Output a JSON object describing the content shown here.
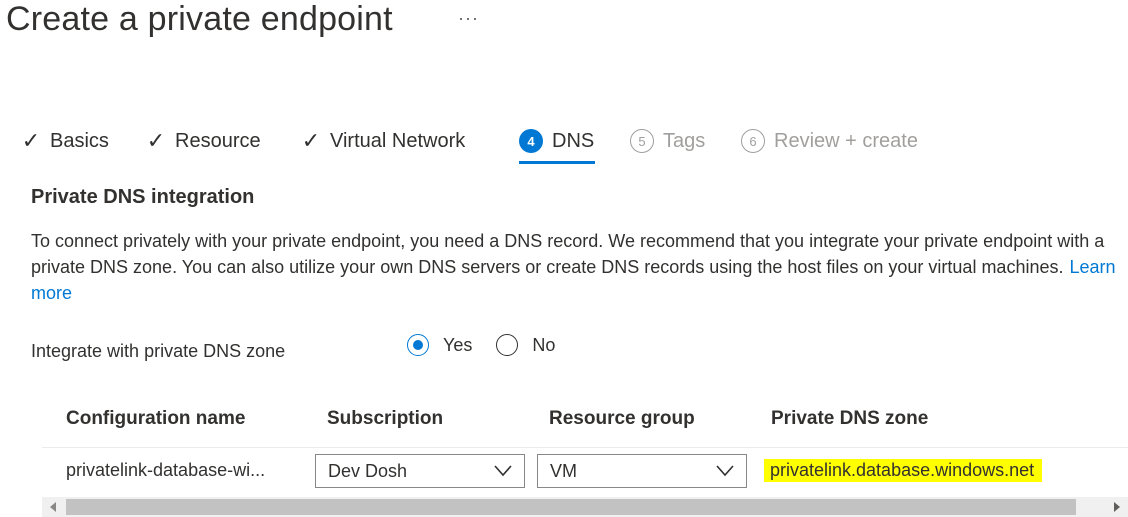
{
  "page": {
    "title": "Create a private endpoint",
    "more": "···"
  },
  "tabs": [
    {
      "label": "Basics",
      "state": "done",
      "marker": "✓"
    },
    {
      "label": "Resource",
      "state": "done",
      "marker": "✓"
    },
    {
      "label": "Virtual Network",
      "state": "done",
      "marker": "✓"
    },
    {
      "label": "DNS",
      "state": "active",
      "marker": "4"
    },
    {
      "label": "Tags",
      "state": "disabled",
      "marker": "5"
    },
    {
      "label": "Review + create",
      "state": "disabled",
      "marker": "6"
    }
  ],
  "section": {
    "title": "Private DNS integration",
    "description": "To connect privately with your private endpoint, you need a DNS record. We recommend that you integrate your private endpoint with a private DNS zone. You can also utilize your own DNS servers or create DNS records using the host files on your virtual machines.",
    "learn_more": "Learn more"
  },
  "integrate": {
    "label": "Integrate with private DNS zone",
    "options": [
      {
        "label": "Yes",
        "selected": true
      },
      {
        "label": "No",
        "selected": false
      }
    ]
  },
  "table": {
    "headers": [
      "Configuration name",
      "Subscription",
      "Resource group",
      "Private DNS zone"
    ],
    "rows": [
      {
        "configuration_name": "privatelink-database-wi...",
        "subscription": "Dev Dosh",
        "resource_group": "VM",
        "private_dns_zone": "privatelink.database.windows.net"
      }
    ]
  },
  "colors": {
    "accent": "#0078d4",
    "highlight": "#ffff00",
    "disabled": "#a19f9d"
  }
}
